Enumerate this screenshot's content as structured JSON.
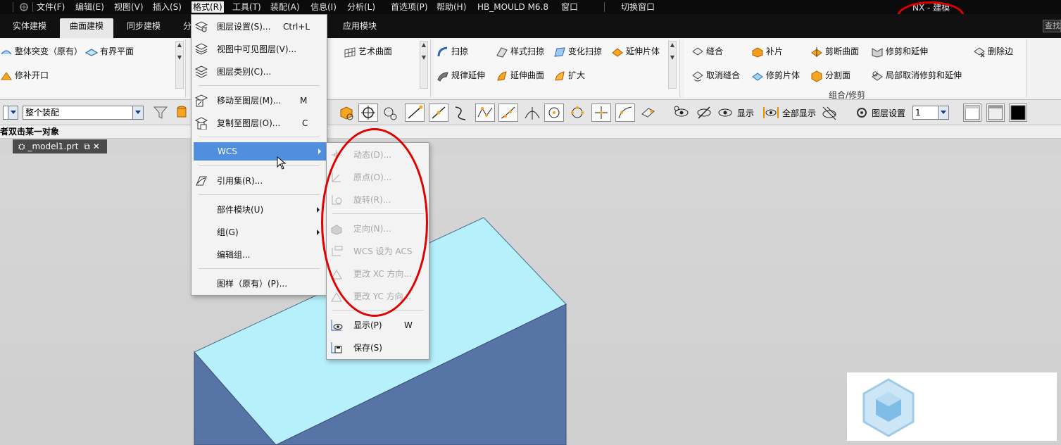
{
  "menubar": {
    "items": [
      "文件(F)",
      "编辑(E)",
      "视图(V)",
      "插入(S)",
      "格式(R)",
      "工具(T)",
      "装配(A)",
      "信息(I)",
      "分析(L)",
      "首选项(P)",
      "帮助(H)",
      "HB_MOULD M6.8",
      "窗口",
      "切换窗口"
    ],
    "app_title": "NX - 建模"
  },
  "tabs": [
    "实体建模",
    "曲面建模",
    "同步建模",
    "分",
    "应用模块"
  ],
  "search_label": "查找",
  "ribbon": {
    "group1": [
      "整体突变（原有）",
      "有界平面",
      "修补开口"
    ],
    "group2": [
      "艺术曲面"
    ],
    "group3": [
      "扫掠",
      "样式扫掠",
      "变化扫掠",
      "延伸片体",
      "规律延伸",
      "延伸曲面",
      "扩大"
    ],
    "group4": [
      "缝合",
      "补片",
      "剪断曲面",
      "修剪和延伸",
      "删除边",
      "取消缝合",
      "修剪片体",
      "分割面",
      "局部取消修剪和延伸"
    ],
    "group4_label": "组合/修剪"
  },
  "toolbar": {
    "assembly_combo": "整个装配",
    "show_label": "显示",
    "show_all_label": "全部显示",
    "layer_settings_label": "图层设置",
    "layer_value": "1"
  },
  "cue_line": "者双击某一对象",
  "file_tab": "_model1.prt",
  "format_menu": {
    "items": [
      {
        "label": "图层设置(S)...",
        "shortcut": "Ctrl+L",
        "icon": "layer-settings-icon"
      },
      {
        "label": "视图中可见图层(V)...",
        "shortcut": "",
        "icon": "visible-layers-icon"
      },
      {
        "label": "图层类别(C)...",
        "shortcut": "",
        "icon": "layer-category-icon"
      },
      {
        "label": "移动至图层(M)...",
        "shortcut": "M",
        "icon": "move-to-layer-icon"
      },
      {
        "label": "复制至图层(O)...",
        "shortcut": "C",
        "icon": "copy-to-layer-icon"
      },
      {
        "label": "WCS",
        "shortcut": "",
        "icon": ""
      },
      {
        "label": "引用集(R)...",
        "shortcut": "",
        "icon": "reference-set-icon"
      },
      {
        "label": "部件模块(U)",
        "shortcut": "",
        "icon": ""
      },
      {
        "label": "组(G)",
        "shortcut": "",
        "icon": ""
      },
      {
        "label": "编辑组...",
        "shortcut": "",
        "icon": ""
      },
      {
        "label": "图样（原有）(P)...",
        "shortcut": "",
        "icon": ""
      }
    ]
  },
  "wcs_menu": {
    "items": [
      {
        "label": "动态(D)...",
        "shortcut": "",
        "enabled": false
      },
      {
        "label": "原点(O)...",
        "shortcut": "",
        "enabled": false
      },
      {
        "label": "旋转(R)...",
        "shortcut": "",
        "enabled": false
      },
      {
        "label": "定向(N)...",
        "shortcut": "",
        "enabled": false
      },
      {
        "label": "WCS 设为 ACS",
        "shortcut": "",
        "enabled": false
      },
      {
        "label": "更改 XC 方向...",
        "shortcut": "",
        "enabled": false
      },
      {
        "label": "更改 YC 方向...",
        "shortcut": "",
        "enabled": false
      },
      {
        "label": "显示(P)",
        "shortcut": "W",
        "enabled": true
      },
      {
        "label": "保存(S)",
        "shortcut": "",
        "enabled": true
      }
    ]
  },
  "colors": {
    "annotation_red": "#e00000",
    "menu_highlight": "#4f8fde",
    "box_top": "#b5f0fb",
    "box_front": "#5674a6",
    "menubar_bg": "#0b0b0b"
  }
}
